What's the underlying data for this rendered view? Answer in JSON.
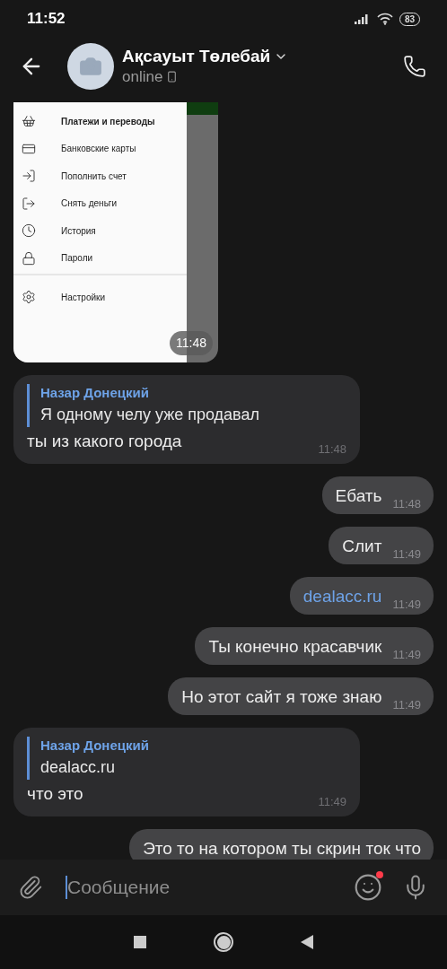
{
  "status_bar": {
    "time": "11:52",
    "battery": "83"
  },
  "header": {
    "name": "Ақсауыт Төлебай",
    "status": "online"
  },
  "messages": [
    {
      "kind": "image",
      "outgoing": false,
      "time": "11:48",
      "screenshot": {
        "menu_groups": [
          [
            {
              "label": "Платежи и переводы",
              "selected": true
            },
            {
              "label": "Банковские карты",
              "selected": false
            },
            {
              "label": "Пополнить счет",
              "selected": false
            },
            {
              "label": "Снять деньги",
              "selected": false
            },
            {
              "label": "История",
              "selected": false
            },
            {
              "label": "Пароли",
              "selected": false
            }
          ],
          [
            {
              "label": "Настройки",
              "selected": false
            }
          ]
        ]
      }
    },
    {
      "kind": "reply",
      "outgoing": false,
      "quote_author": "Назар Донецкий",
      "quote_text": "Я одному челу уже продавал",
      "text": "ты из какого города",
      "time": "11:48"
    },
    {
      "kind": "text",
      "outgoing": true,
      "text": "Ебать",
      "time": "11:48"
    },
    {
      "kind": "text",
      "outgoing": true,
      "text": "Слит",
      "time": "11:49"
    },
    {
      "kind": "link",
      "outgoing": true,
      "text": "dealacc.ru",
      "time": "11:49"
    },
    {
      "kind": "text",
      "outgoing": true,
      "text": "Ты конечно красавчик",
      "time": "11:49"
    },
    {
      "kind": "text",
      "outgoing": true,
      "text": "Но этот сайт я тоже знаю",
      "time": "11:49"
    },
    {
      "kind": "reply",
      "outgoing": false,
      "quote_author": "Назар Донецкий",
      "quote_text": "dealacc.ru",
      "text": "что это",
      "time": "11:49"
    },
    {
      "kind": "text",
      "outgoing": true,
      "text": "Это то на котором ты скрин ток что"
    }
  ],
  "composer": {
    "placeholder": "Сообщение"
  }
}
